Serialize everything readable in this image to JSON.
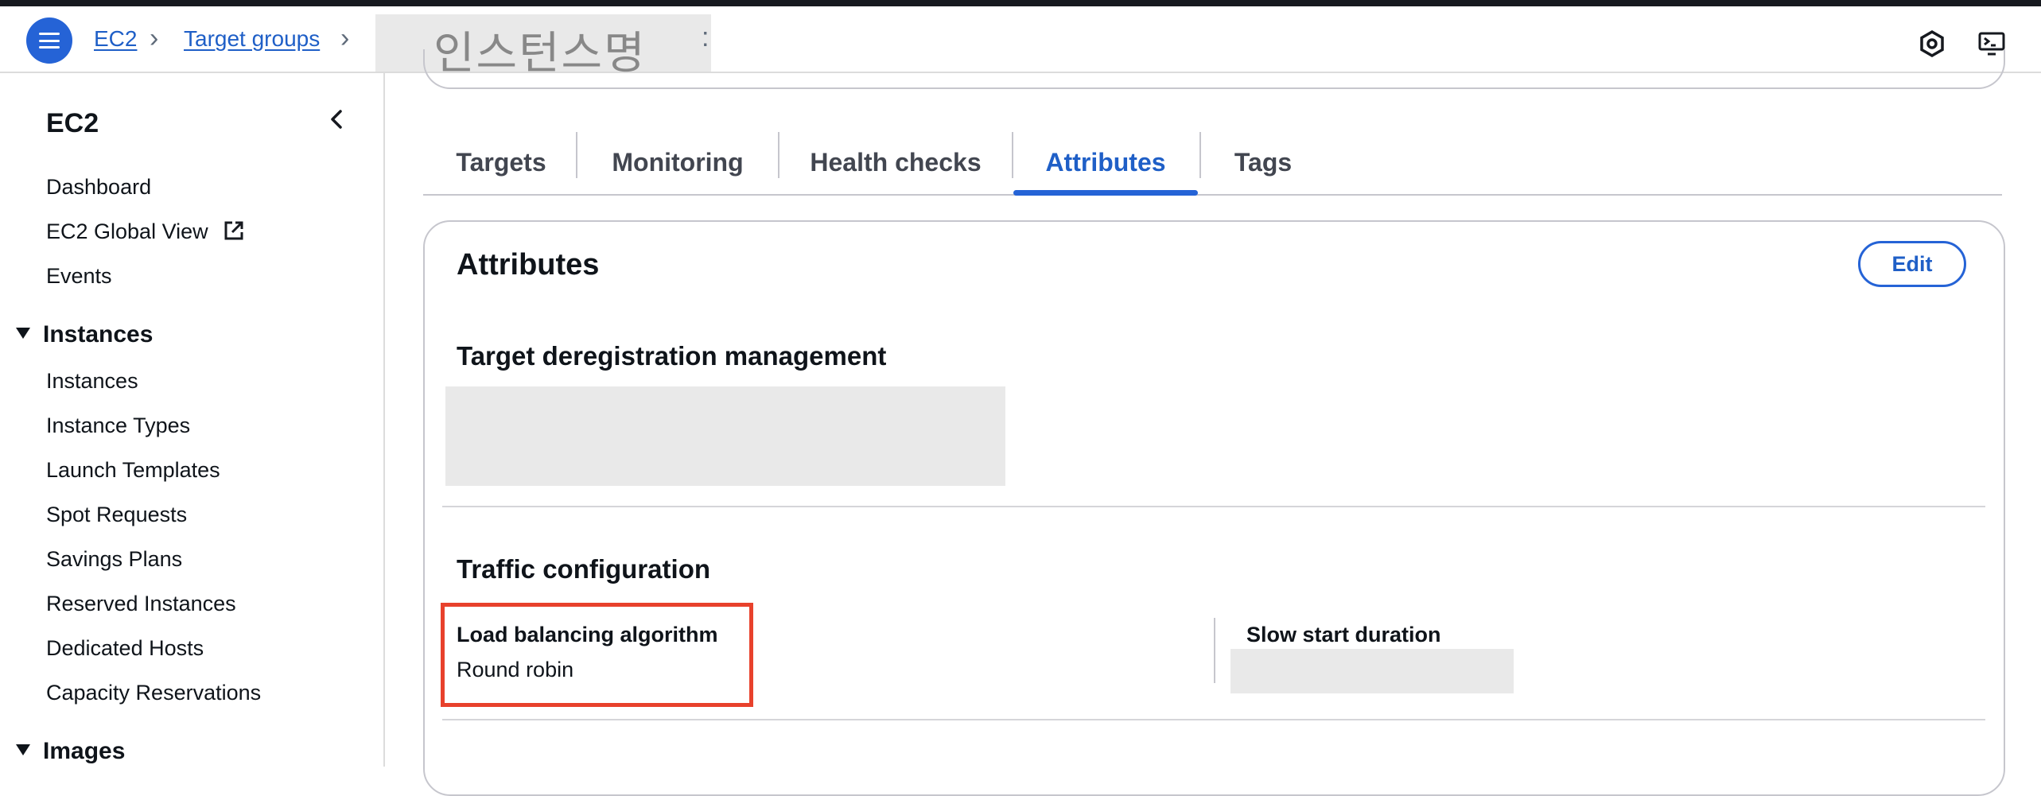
{
  "header": {
    "breadcrumb": [
      {
        "label": "EC2"
      },
      {
        "label": "Target groups"
      }
    ],
    "current_redacted_text": "인스턴스명",
    "icons": [
      "hexagon-settings-icon",
      "cloudshell-icon"
    ]
  },
  "sidebar": {
    "title": "EC2",
    "items_top": [
      "Dashboard",
      "EC2 Global View",
      "Events"
    ],
    "sections": [
      {
        "label": "Instances",
        "items": [
          "Instances",
          "Instance Types",
          "Launch Templates",
          "Spot Requests",
          "Savings Plans",
          "Reserved Instances",
          "Dedicated Hosts",
          "Capacity Reservations"
        ]
      },
      {
        "label": "Images",
        "items": []
      }
    ]
  },
  "tabs": [
    {
      "label": "Targets"
    },
    {
      "label": "Monitoring"
    },
    {
      "label": "Health checks"
    },
    {
      "label": "Attributes",
      "active": true
    },
    {
      "label": "Tags"
    }
  ],
  "attributes": {
    "title": "Attributes",
    "edit_label": "Edit",
    "deregistration": {
      "title": "Target deregistration management"
    },
    "traffic": {
      "title": "Traffic configuration",
      "lb_algorithm_label": "Load balancing algorithm",
      "lb_algorithm_value": "Round robin",
      "slow_start_label": "Slow start duration"
    }
  },
  "colors": {
    "accent": "#2563d6",
    "highlight_border": "#e8412c"
  }
}
